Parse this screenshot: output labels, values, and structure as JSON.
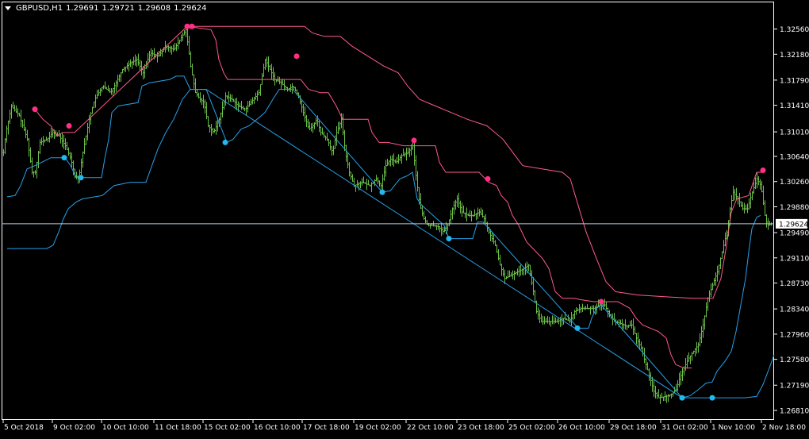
{
  "header": {
    "symbol": "GBPUSD,H1",
    "open": "1.29691",
    "high": "1.29721",
    "low": "1.29608",
    "close": "1.29624"
  },
  "colors": {
    "background": "#000000",
    "frame": "#ffffff",
    "bars": "#6cbf4a",
    "upper_channel": "#ff5a8c",
    "lower_channel": "#28a0e8",
    "upper_dot": "#ff2f86",
    "lower_dot": "#22b8f0",
    "bid_line": "#b8c8d8"
  },
  "chart_data": {
    "type": "ohlc",
    "symbol": "GBPUSD",
    "timeframe": "H1",
    "y_ticks": [
      "1.32560",
      "1.32180",
      "1.31790",
      "1.31410",
      "1.31010",
      "1.30640",
      "1.30260",
      "1.29880",
      "1.29490",
      "1.29110",
      "1.28730",
      "1.28340",
      "1.27960",
      "1.27580",
      "1.27190",
      "1.26810"
    ],
    "x_ticks": [
      "5 Oct 2018",
      "9 Oct 02:00",
      "10 Oct 10:00",
      "11 Oct 18:00",
      "15 Oct 02:00",
      "16 Oct 10:00",
      "17 Oct 18:00",
      "19 Oct 02:00",
      "22 Oct 10:00",
      "23 Oct 18:00",
      "25 Oct 02:00",
      "26 Oct 10:00",
      "29 Oct 18:00",
      "31 Oct 02:00",
      "1 Nov 10:00",
      "2 Nov 18:00"
    ],
    "ylim": [
      1.2675,
      1.3283
    ],
    "bid_price": "1.29624",
    "price_series": [
      [
        0,
        1.307
      ],
      [
        3,
        1.31
      ],
      [
        10,
        1.314
      ],
      [
        20,
        1.3125
      ],
      [
        30,
        1.309
      ],
      [
        36,
        1.304
      ],
      [
        40,
        1.304
      ],
      [
        46,
        1.3085
      ],
      [
        55,
        1.309
      ],
      [
        62,
        1.31
      ],
      [
        70,
        1.3095
      ],
      [
        78,
        1.308
      ],
      [
        85,
        1.306
      ],
      [
        90,
        1.3035
      ],
      [
        95,
        1.3032
      ],
      [
        100,
        1.307
      ],
      [
        108,
        1.312
      ],
      [
        115,
        1.315
      ],
      [
        125,
        1.317
      ],
      [
        135,
        1.316
      ],
      [
        142,
        1.3175
      ],
      [
        150,
        1.3195
      ],
      [
        160,
        1.3205
      ],
      [
        168,
        1.321
      ],
      [
        176,
        1.319
      ],
      [
        185,
        1.322
      ],
      [
        195,
        1.3215
      ],
      [
        205,
        1.323
      ],
      [
        215,
        1.3225
      ],
      [
        225,
        1.3245
      ],
      [
        230,
        1.3255
      ],
      [
        236,
        1.32
      ],
      [
        242,
        1.316
      ],
      [
        248,
        1.315
      ],
      [
        253,
        1.3145
      ],
      [
        258,
        1.311
      ],
      [
        265,
        1.31
      ],
      [
        272,
        1.312
      ],
      [
        280,
        1.3155
      ],
      [
        288,
        1.315
      ],
      [
        296,
        1.314
      ],
      [
        305,
        1.3135
      ],
      [
        315,
        1.315
      ],
      [
        322,
        1.316
      ],
      [
        330,
        1.321
      ],
      [
        336,
        1.3195
      ],
      [
        342,
        1.318
      ],
      [
        350,
        1.3175
      ],
      [
        358,
        1.3165
      ],
      [
        365,
        1.317
      ],
      [
        372,
        1.3155
      ],
      [
        378,
        1.313
      ],
      [
        385,
        1.3105
      ],
      [
        390,
        1.311
      ],
      [
        395,
        1.312
      ],
      [
        400,
        1.31
      ],
      [
        408,
        1.309
      ],
      [
        415,
        1.307
      ],
      [
        420,
        1.31
      ],
      [
        426,
        1.312
      ],
      [
        431,
        1.307
      ],
      [
        436,
        1.304
      ],
      [
        442,
        1.302
      ],
      [
        452,
        1.3025
      ],
      [
        462,
        1.302
      ],
      [
        470,
        1.303
      ],
      [
        476,
        1.302
      ],
      [
        482,
        1.305
      ],
      [
        488,
        1.306
      ],
      [
        495,
        1.3055
      ],
      [
        502,
        1.3065
      ],
      [
        510,
        1.307
      ],
      [
        516,
        1.308
      ],
      [
        520,
        1.3035
      ],
      [
        525,
        1.299
      ],
      [
        530,
        1.297
      ],
      [
        535,
        1.296
      ],
      [
        542,
        1.296
      ],
      [
        548,
        1.2958
      ],
      [
        555,
        1.295
      ],
      [
        560,
        1.296
      ],
      [
        566,
        1.2985
      ],
      [
        572,
        1.3
      ],
      [
        578,
        1.298
      ],
      [
        585,
        1.2975
      ],
      [
        592,
        1.2975
      ],
      [
        600,
        1.298
      ],
      [
        606,
        1.297
      ],
      [
        612,
        1.295
      ],
      [
        620,
        1.293
      ],
      [
        626,
        1.29
      ],
      [
        632,
        1.288
      ],
      [
        640,
        1.2885
      ],
      [
        648,
        1.289
      ],
      [
        656,
        1.2895
      ],
      [
        662,
        1.29
      ],
      [
        668,
        1.286
      ],
      [
        672,
        1.283
      ],
      [
        678,
        1.2815
      ],
      [
        688,
        1.2815
      ],
      [
        698,
        1.2815
      ],
      [
        706,
        1.282
      ],
      [
        714,
        1.2815
      ],
      [
        720,
        1.283
      ],
      [
        728,
        1.2835
      ],
      [
        736,
        1.2835
      ],
      [
        744,
        1.2835
      ],
      [
        752,
        1.284
      ],
      [
        758,
        1.284
      ],
      [
        764,
        1.2825
      ],
      [
        770,
        1.2815
      ],
      [
        778,
        1.2812
      ],
      [
        786,
        1.2808
      ],
      [
        792,
        1.281
      ],
      [
        798,
        1.279
      ],
      [
        804,
        1.2775
      ],
      [
        810,
        1.275
      ],
      [
        815,
        1.273
      ],
      [
        820,
        1.271
      ],
      [
        826,
        1.27
      ],
      [
        834,
        1.2702
      ],
      [
        842,
        1.2705
      ],
      [
        848,
        1.2712
      ],
      [
        852,
        1.2728
      ],
      [
        858,
        1.2745
      ],
      [
        864,
        1.276
      ],
      [
        870,
        1.277
      ],
      [
        876,
        1.278
      ],
      [
        882,
        1.281
      ],
      [
        888,
        1.285
      ],
      [
        894,
        1.287
      ],
      [
        900,
        1.289
      ],
      [
        906,
        1.292
      ],
      [
        912,
        1.295
      ],
      [
        916,
        1.2985
      ],
      [
        920,
        1.301
      ],
      [
        926,
        1.3
      ],
      [
        932,
        1.2985
      ],
      [
        938,
        1.2985
      ],
      [
        944,
        1.301
      ],
      [
        950,
        1.303
      ],
      [
        955,
        1.302
      ],
      [
        960,
        1.2975
      ],
      [
        963,
        1.296
      ],
      [
        968,
        1.2962
      ]
    ],
    "upper_channel": [
      [
        40,
        1.3135
      ],
      [
        50,
        1.312
      ],
      [
        60,
        1.311
      ],
      [
        68,
        1.3095
      ],
      [
        75,
        1.31
      ],
      [
        90,
        1.31
      ],
      [
        232,
        1.326
      ],
      [
        262,
        1.3255
      ],
      [
        268,
        1.324
      ],
      [
        272,
        1.321
      ],
      [
        278,
        1.319
      ],
      [
        283,
        1.318
      ],
      [
        300,
        1.318
      ],
      [
        375,
        1.318
      ],
      [
        385,
        1.3165
      ],
      [
        400,
        1.316
      ],
      [
        410,
        1.316
      ],
      [
        420,
        1.314
      ],
      [
        428,
        1.312
      ],
      [
        460,
        1.312
      ],
      [
        465,
        1.31
      ],
      [
        474,
        1.3085
      ],
      [
        485,
        1.3085
      ],
      [
        505,
        1.308
      ],
      [
        545,
        1.308
      ],
      [
        550,
        1.3055
      ],
      [
        558,
        1.304
      ],
      [
        570,
        1.304
      ],
      [
        600,
        1.304
      ],
      [
        612,
        1.3025
      ],
      [
        622,
        1.302
      ],
      [
        628,
        1.3005
      ],
      [
        636,
        1.2995
      ],
      [
        642,
        1.2975
      ],
      [
        650,
        1.296
      ],
      [
        660,
        1.2935
      ],
      [
        668,
        1.2925
      ],
      [
        680,
        1.291
      ],
      [
        688,
        1.2895
      ],
      [
        696,
        1.286
      ],
      [
        705,
        1.285
      ],
      [
        720,
        1.285
      ],
      [
        728,
        1.2848
      ],
      [
        745,
        1.2845
      ],
      [
        755,
        1.2845
      ],
      [
        775,
        1.2845
      ],
      [
        790,
        1.2835
      ],
      [
        798,
        1.282
      ],
      [
        806,
        1.281
      ],
      [
        816,
        1.2805
      ],
      [
        826,
        1.28
      ],
      [
        836,
        1.279
      ],
      [
        842,
        1.2765
      ],
      [
        848,
        1.275
      ],
      [
        858,
        1.2745
      ],
      [
        868,
        1.2745
      ]
    ],
    "upper_channel_2": [
      [
        232,
        1.326
      ],
      [
        380,
        1.326
      ],
      [
        390,
        1.325
      ],
      [
        405,
        1.3245
      ],
      [
        425,
        1.3245
      ],
      [
        440,
        1.323
      ],
      [
        460,
        1.3215
      ],
      [
        480,
        1.32
      ],
      [
        498,
        1.319
      ],
      [
        510,
        1.317
      ],
      [
        525,
        1.315
      ],
      [
        545,
        1.314
      ],
      [
        565,
        1.313
      ],
      [
        585,
        1.312
      ],
      [
        610,
        1.311
      ],
      [
        630,
        1.309
      ],
      [
        655,
        1.305
      ],
      [
        680,
        1.3045
      ],
      [
        705,
        1.304
      ],
      [
        715,
        1.303
      ],
      [
        725,
        1.299
      ],
      [
        735,
        1.295
      ],
      [
        748,
        1.291
      ],
      [
        760,
        1.2875
      ],
      [
        772,
        1.286
      ],
      [
        800,
        1.2855
      ],
      [
        840,
        1.2852
      ],
      [
        870,
        1.285
      ],
      [
        895,
        1.285
      ],
      [
        905,
        1.288
      ],
      [
        912,
        1.293
      ],
      [
        918,
        1.298
      ],
      [
        925,
        1.3
      ],
      [
        940,
        1.3005
      ],
      [
        950,
        1.304
      ],
      [
        960,
        1.304
      ]
    ],
    "lower_channel": [
      [
        5,
        1.3003
      ],
      [
        15,
        1.3005
      ],
      [
        22,
        1.302
      ],
      [
        30,
        1.3045
      ],
      [
        40,
        1.305
      ],
      [
        60,
        1.3062
      ],
      [
        78,
        1.3062
      ],
      [
        85,
        1.305
      ],
      [
        92,
        1.3032
      ],
      [
        98,
        1.3032
      ],
      [
        124,
        1.3032
      ],
      [
        128,
        1.306
      ],
      [
        133,
        1.309
      ],
      [
        137,
        1.313
      ],
      [
        145,
        1.314
      ],
      [
        170,
        1.3145
      ],
      [
        175,
        1.317
      ],
      [
        185,
        1.3175
      ],
      [
        210,
        1.318
      ],
      [
        218,
        1.3185
      ],
      [
        228,
        1.3185
      ],
      [
        236,
        1.3165
      ],
      [
        245,
        1.3165
      ],
      [
        256,
        1.3165
      ],
      [
        282,
        1.3085
      ],
      [
        290,
        1.309
      ],
      [
        300,
        1.3105
      ],
      [
        310,
        1.311
      ],
      [
        320,
        1.312
      ],
      [
        330,
        1.313
      ],
      [
        340,
        1.315
      ],
      [
        348,
        1.3165
      ],
      [
        356,
        1.3165
      ],
      [
        365,
        1.3165
      ],
      [
        478,
        1.301
      ],
      [
        488,
        1.3012
      ],
      [
        500,
        1.303
      ],
      [
        510,
        1.3035
      ],
      [
        516,
        1.304
      ],
      [
        522,
        1.3
      ],
      [
        528,
        1.299
      ],
      [
        556,
        1.296
      ],
      [
        562,
        1.294
      ],
      [
        580,
        1.294
      ],
      [
        592,
        1.294
      ],
      [
        598,
        1.2965
      ],
      [
        605,
        1.2965
      ],
      [
        725,
        1.2805
      ],
      [
        738,
        1.2805
      ],
      [
        742,
        1.282
      ],
      [
        748,
        1.2835
      ],
      [
        754,
        1.284
      ],
      [
        856,
        1.27
      ],
      [
        866,
        1.2703
      ],
      [
        876,
        1.2712
      ],
      [
        886,
        1.2722
      ],
      [
        894,
        1.2724
      ],
      [
        900,
        1.274
      ],
      [
        910,
        1.2755
      ],
      [
        918,
        1.277
      ],
      [
        924,
        1.28
      ],
      [
        930,
        1.284
      ],
      [
        936,
        1.288
      ],
      [
        940,
        1.292
      ],
      [
        944,
        1.2955
      ],
      [
        950,
        1.2972
      ],
      [
        955,
        1.2975
      ]
    ],
    "lower_channel_2": [
      [
        5,
        1.2925
      ],
      [
        40,
        1.2925
      ],
      [
        55,
        1.2925
      ],
      [
        63,
        1.293
      ],
      [
        70,
        1.295
      ],
      [
        76,
        1.297
      ],
      [
        82,
        1.2985
      ],
      [
        92,
        1.2995
      ],
      [
        100,
        1.3
      ],
      [
        125,
        1.3005
      ],
      [
        140,
        1.302
      ],
      [
        160,
        1.3025
      ],
      [
        180,
        1.3025
      ],
      [
        195,
        1.3075
      ],
      [
        205,
        1.31
      ],
      [
        215,
        1.312
      ],
      [
        226,
        1.315
      ],
      [
        236,
        1.3165
      ],
      [
        256,
        1.3165
      ],
      [
        856,
        1.27
      ],
      [
        880,
        1.27
      ],
      [
        894,
        1.27
      ],
      [
        935,
        1.27
      ],
      [
        950,
        1.2702
      ],
      [
        958,
        1.272
      ],
      [
        966,
        1.2745
      ],
      [
        972,
        1.2765
      ]
    ],
    "upper_dots": [
      [
        40,
        1.3135
      ],
      [
        83,
        1.311
      ],
      [
        232,
        1.326
      ],
      [
        238,
        1.326
      ],
      [
        370,
        1.3215
      ],
      [
        518,
        1.3088
      ],
      [
        611,
        1.303
      ],
      [
        754,
        1.2845
      ],
      [
        958,
        1.3043
      ]
    ],
    "lower_dots": [
      [
        77,
        1.3062
      ],
      [
        98,
        1.3032
      ],
      [
        280,
        1.3085
      ],
      [
        478,
        1.301
      ],
      [
        562,
        1.294
      ],
      [
        724,
        1.2805
      ],
      [
        856,
        1.27
      ],
      [
        894,
        1.27
      ]
    ]
  }
}
